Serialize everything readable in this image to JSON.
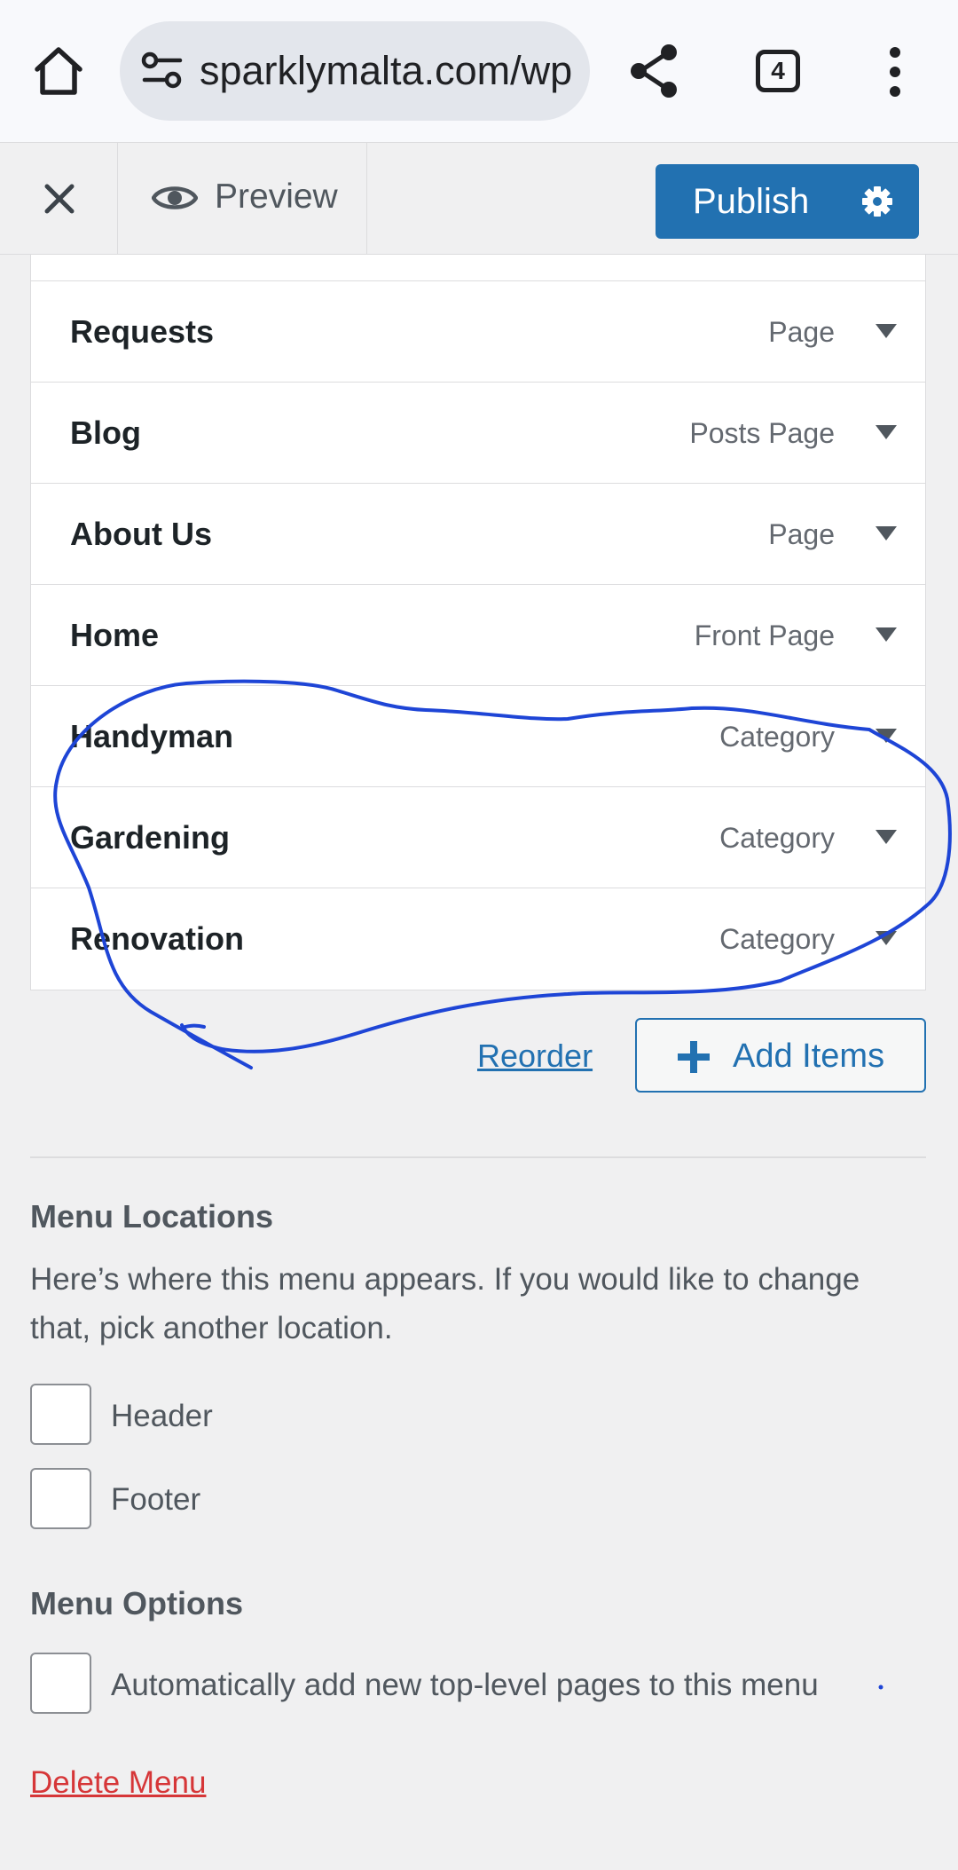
{
  "browser": {
    "url": "sparklymalta.com/wp-admin/customize.php",
    "tab_count": "4",
    "icons": {
      "home": "home-icon",
      "site_info": "tune-icon",
      "share": "share-icon",
      "tabs": "tab-switcher-icon",
      "more": "more-vert-icon"
    }
  },
  "customizer": {
    "preview_label": "Preview",
    "publish_label": "Publish",
    "colors": {
      "accent": "#2271b1",
      "danger": "#d63638"
    }
  },
  "menu_items": [
    {
      "title": "Requests",
      "type": "Page"
    },
    {
      "title": "Blog",
      "type": "Posts Page"
    },
    {
      "title": "About Us",
      "type": "Page"
    },
    {
      "title": "Home",
      "type": "Front Page"
    },
    {
      "title": "Handyman",
      "type": "Category"
    },
    {
      "title": "Gardening",
      "type": "Category"
    },
    {
      "title": "Renovation",
      "type": "Category"
    }
  ],
  "actions": {
    "reorder_label": "Reorder",
    "add_items_label": "Add Items"
  },
  "menu_locations": {
    "title": "Menu Locations",
    "description": "Here’s where this menu appears. If you would like to change that, pick another location.",
    "options": [
      {
        "label": "Header",
        "checked": false
      },
      {
        "label": "Footer",
        "checked": false
      }
    ]
  },
  "menu_options": {
    "title": "Menu Options",
    "auto_add_label": "Automatically add new top-level pages to this menu",
    "auto_add_checked": false
  },
  "delete_label": "Delete Menu",
  "annotation": {
    "color": "#1e45d6"
  }
}
